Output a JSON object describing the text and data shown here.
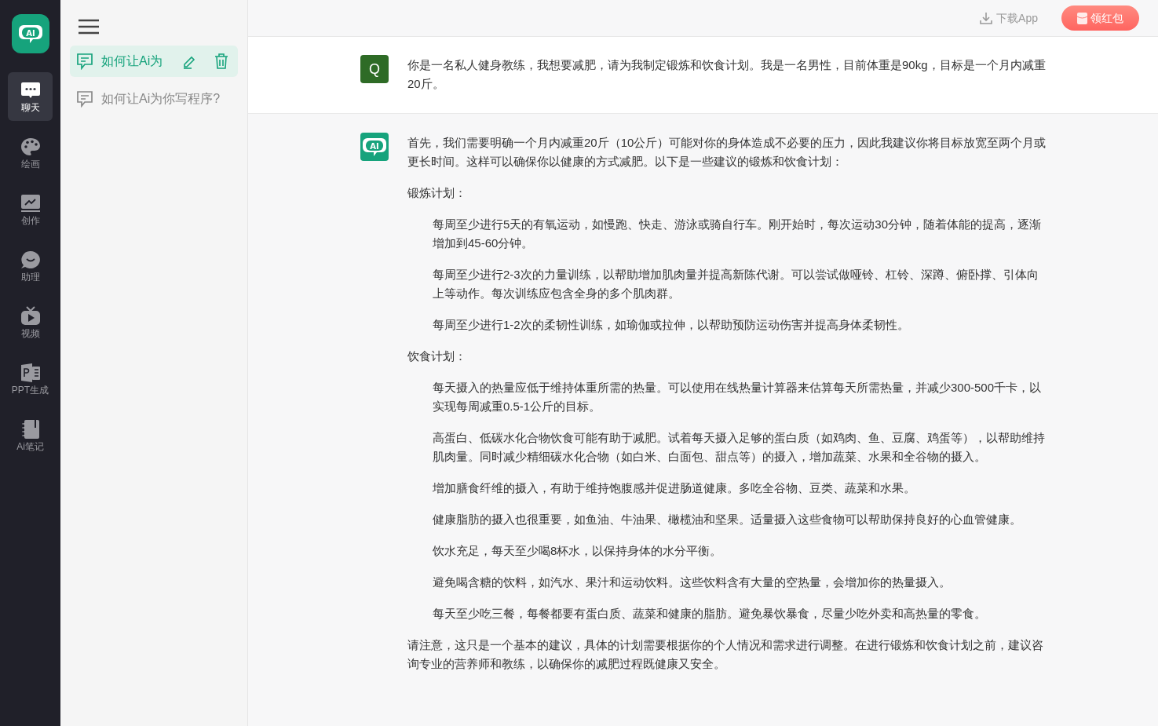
{
  "logo_text": "AI",
  "nav": [
    {
      "kind": "chat",
      "label": "聊天",
      "selected": true
    },
    {
      "kind": "palette",
      "label": "绘画",
      "selected": false
    },
    {
      "kind": "chart",
      "label": "创作",
      "selected": false
    },
    {
      "kind": "assistant",
      "label": "助理",
      "selected": false
    },
    {
      "kind": "video",
      "label": "视频",
      "selected": false
    },
    {
      "kind": "ppt",
      "label": "PPT生成",
      "selected": false
    },
    {
      "kind": "notebook",
      "label": "Ai笔记",
      "selected": false
    }
  ],
  "conversations": [
    {
      "title": "如何让Ai为",
      "selected": true
    },
    {
      "title": "如何让Ai为你写程序?",
      "selected": false
    }
  ],
  "topbar": {
    "download": "下载App",
    "red_packet": "领红包"
  },
  "answer_avatar_text": "AI",
  "question": {
    "avatar": "Q",
    "text": "你是一名私人健身教练，我想要减肥，请为我制定锻炼和饮食计划。我是一名男性，目前体重是90kg，目标是一个月内减重20斤。"
  },
  "answer": [
    {
      "kind": "paragraph",
      "text": "首先，我们需要明确一个月内减重20斤（10公斤）可能对你的身体造成不必要的压力，因此我建议你将目标放宽至两个月或更长时间。这样可以确保你以健康的方式减肥。以下是一些建议的锻炼和饮食计划："
    },
    {
      "kind": "paragraph",
      "text": "锻炼计划："
    },
    {
      "kind": "item",
      "text": "每周至少进行5天的有氧运动，如慢跑、快走、游泳或骑自行车。刚开始时，每次运动30分钟，随着体能的提高，逐渐增加到45-60分钟。"
    },
    {
      "kind": "item",
      "text": "每周至少进行2-3次的力量训练，以帮助增加肌肉量并提高新陈代谢。可以尝试做哑铃、杠铃、深蹲、俯卧撑、引体向上等动作。每次训练应包含全身的多个肌肉群。"
    },
    {
      "kind": "item",
      "text": "每周至少进行1-2次的柔韧性训练，如瑜伽或拉伸，以帮助预防运动伤害并提高身体柔韧性。"
    },
    {
      "kind": "paragraph",
      "text": "饮食计划："
    },
    {
      "kind": "item",
      "text": "每天摄入的热量应低于维持体重所需的热量。可以使用在线热量计算器来估算每天所需热量，并减少300-500千卡，以实现每周减重0.5-1公斤的目标。"
    },
    {
      "kind": "item",
      "text": "高蛋白、低碳水化合物饮食可能有助于减肥。试着每天摄入足够的蛋白质（如鸡肉、鱼、豆腐、鸡蛋等），以帮助维持肌肉量。同时减少精细碳水化合物（如白米、白面包、甜点等）的摄入，增加蔬菜、水果和全谷物的摄入。"
    },
    {
      "kind": "item",
      "text": "增加膳食纤维的摄入，有助于维持饱腹感并促进肠道健康。多吃全谷物、豆类、蔬菜和水果。"
    },
    {
      "kind": "item",
      "text": "健康脂肪的摄入也很重要，如鱼油、牛油果、橄榄油和坚果。适量摄入这些食物可以帮助保持良好的心血管健康。"
    },
    {
      "kind": "item",
      "text": "饮水充足，每天至少喝8杯水，以保持身体的水分平衡。"
    },
    {
      "kind": "item",
      "text": "避免喝含糖的饮料，如汽水、果汁和运动饮料。这些饮料含有大量的空热量，会增加你的热量摄入。"
    },
    {
      "kind": "item",
      "text": "每天至少吃三餐，每餐都要有蛋白质、蔬菜和健康的脂肪。避免暴饮暴食，尽量少吃外卖和高热量的零食。"
    },
    {
      "kind": "paragraph",
      "text": "请注意，这只是一个基本的建议，具体的计划需要根据你的个人情况和需求进行调整。在进行锻炼和饮食计划之前，建议咨询专业的营养师和教练，以确保你的减肥过程既健康又安全。"
    }
  ]
}
